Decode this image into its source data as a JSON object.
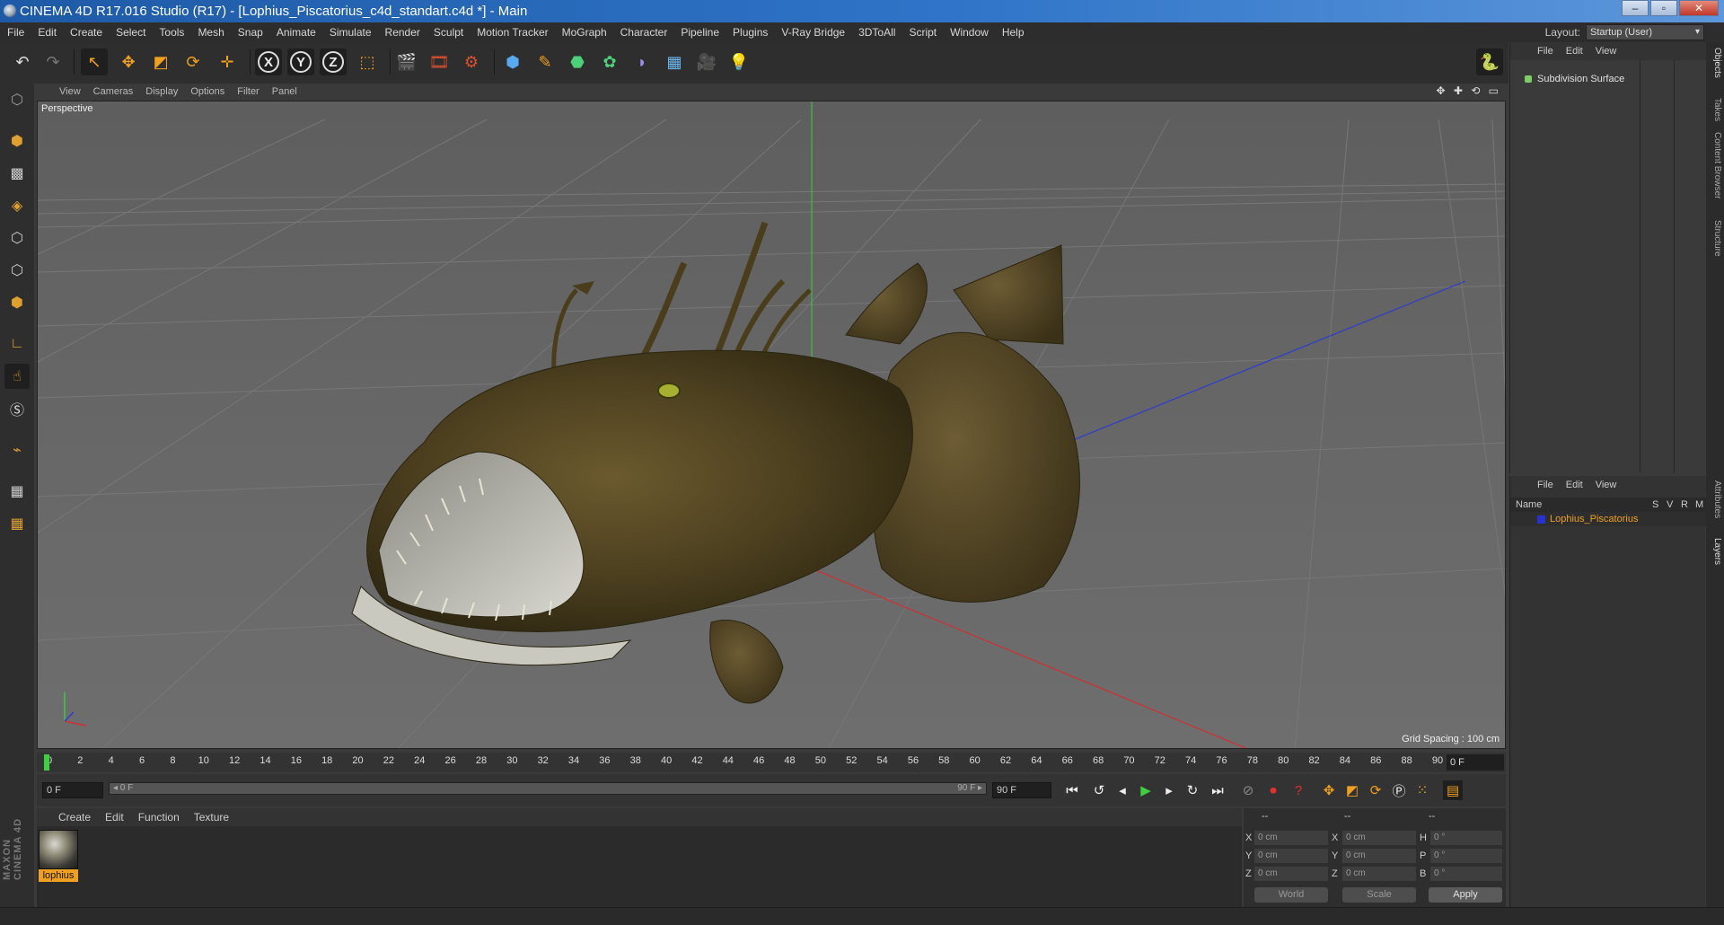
{
  "window": {
    "title": "CINEMA 4D R17.016 Studio (R17) - [Lophius_Piscatorius_c4d_standart.c4d *] - Main",
    "buttons": [
      "–",
      "▫",
      "✕"
    ]
  },
  "menu": [
    "File",
    "Edit",
    "Create",
    "Select",
    "Tools",
    "Mesh",
    "Snap",
    "Animate",
    "Simulate",
    "Render",
    "Sculpt",
    "Motion Tracker",
    "MoGraph",
    "Character",
    "Pipeline",
    "Plugins",
    "V-Ray Bridge",
    "3DToAll",
    "Script",
    "Window",
    "Help"
  ],
  "layout": {
    "label": "Layout:",
    "value": "Startup (User)"
  },
  "axis_buttons": [
    "X",
    "Y",
    "Z"
  ],
  "viewport": {
    "menu": [
      "View",
      "Cameras",
      "Display",
      "Options",
      "Filter",
      "Panel"
    ],
    "camera": "Perspective",
    "grid_spacing": "Grid Spacing : 100 cm",
    "nav_icons": "✥ ✚ ⟲ ▭"
  },
  "timeline": {
    "ticks": [
      "0",
      "2",
      "4",
      "6",
      "8",
      "10",
      "12",
      "14",
      "16",
      "18",
      "20",
      "22",
      "24",
      "26",
      "28",
      "30",
      "32",
      "34",
      "36",
      "38",
      "40",
      "42",
      "44",
      "46",
      "48",
      "50",
      "52",
      "54",
      "56",
      "58",
      "60",
      "62",
      "64",
      "66",
      "68",
      "70",
      "72",
      "74",
      "76",
      "78",
      "80",
      "82",
      "84",
      "86",
      "88",
      "90"
    ],
    "current_frame": "0 F"
  },
  "transport": {
    "start": "0 F",
    "range_start": "◂ 0 F",
    "range_end": "90 F ▸",
    "end": "90 F"
  },
  "material_manager": {
    "menu": [
      "Create",
      "Edit",
      "Function",
      "Texture"
    ],
    "material_name": "lophius"
  },
  "coordinates": {
    "headers": [
      "--",
      "--",
      "--"
    ],
    "rows": [
      {
        "a": "X",
        "av": "0 cm",
        "b": "X",
        "bv": "0 cm",
        "c": "H",
        "cv": "0 °"
      },
      {
        "a": "Y",
        "av": "0 cm",
        "b": "Y",
        "bv": "0 cm",
        "c": "P",
        "cv": "0 °"
      },
      {
        "a": "Z",
        "av": "0 cm",
        "b": "Z",
        "bv": "0 cm",
        "c": "B",
        "cv": "0 °"
      }
    ],
    "mode": "World",
    "size_mode": "Scale",
    "apply": "Apply"
  },
  "objects_panel": {
    "menu": [
      "File",
      "Edit",
      "View"
    ],
    "object": "Subdivision Surface"
  },
  "layers_panel": {
    "menu": [
      "File",
      "Edit",
      "View"
    ],
    "columns": [
      "Name",
      "S",
      "V",
      "R",
      "M"
    ],
    "layer": "Lophius_Piscatorius"
  },
  "side_tabs": [
    "Objects",
    "Takes",
    "Content Browser",
    "Structure",
    "Attributes",
    "Layers"
  ],
  "brand": "MAXON CINEMA 4D"
}
